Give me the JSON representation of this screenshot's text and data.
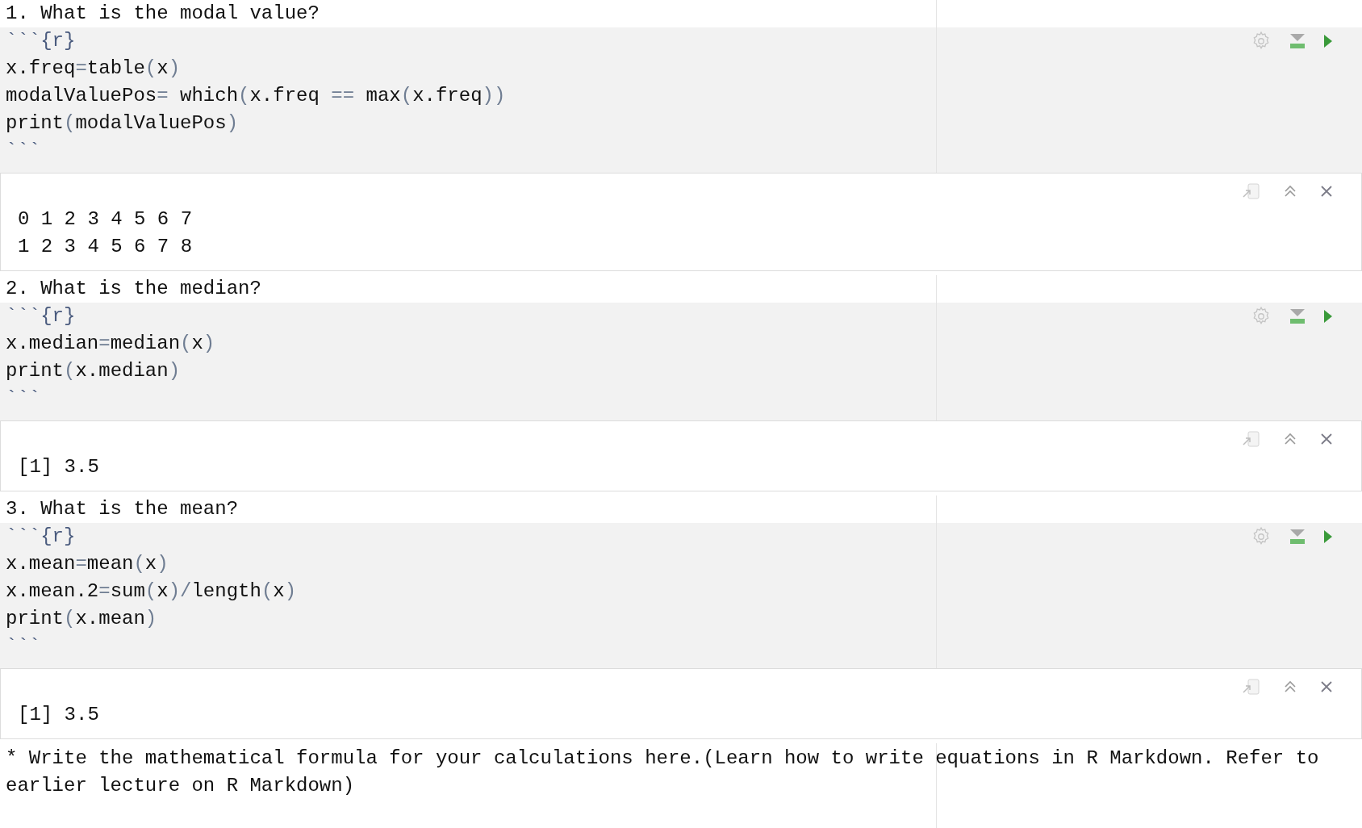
{
  "sections": [
    {
      "heading": "1. What is the modal value?",
      "chunk": {
        "lines": [
          {
            "kind": "fence",
            "text": "```{r}"
          },
          {
            "kind": "code",
            "text": "x.freq=table(x)"
          },
          {
            "kind": "code",
            "text": "modalValuePos= which(x.freq == max(x.freq))"
          },
          {
            "kind": "code",
            "text": "print(modalValuePos)"
          },
          {
            "kind": "fence",
            "text": "```"
          }
        ]
      },
      "output": {
        "lines": [
          "0 1 2 3 4 5 6 7",
          "1 2 3 4 5 6 7 8"
        ]
      }
    },
    {
      "heading": "2. What is the median?",
      "chunk": {
        "lines": [
          {
            "kind": "fence",
            "text": "```{r}"
          },
          {
            "kind": "code",
            "text": "x.median=median(x)"
          },
          {
            "kind": "code",
            "text": "print(x.median)"
          },
          {
            "kind": "fence",
            "text": "```"
          }
        ]
      },
      "output": {
        "lines": [
          "[1] 3.5"
        ]
      }
    },
    {
      "heading": "3. What is the mean?",
      "chunk": {
        "lines": [
          {
            "kind": "fence",
            "text": "```{r}"
          },
          {
            "kind": "code",
            "text": "x.mean=mean(x)"
          },
          {
            "kind": "code",
            "text": "x.mean.2=sum(x)/length(x)"
          },
          {
            "kind": "code",
            "text": "print(x.mean)"
          },
          {
            "kind": "fence",
            "text": "```"
          }
        ]
      },
      "output": {
        "lines": [
          "[1] 3.5"
        ]
      }
    }
  ],
  "note": "* Write the mathematical formula for your calculations here.(Learn how to write equations in R Markdown. Refer to earlier lecture on R Markdown)"
}
